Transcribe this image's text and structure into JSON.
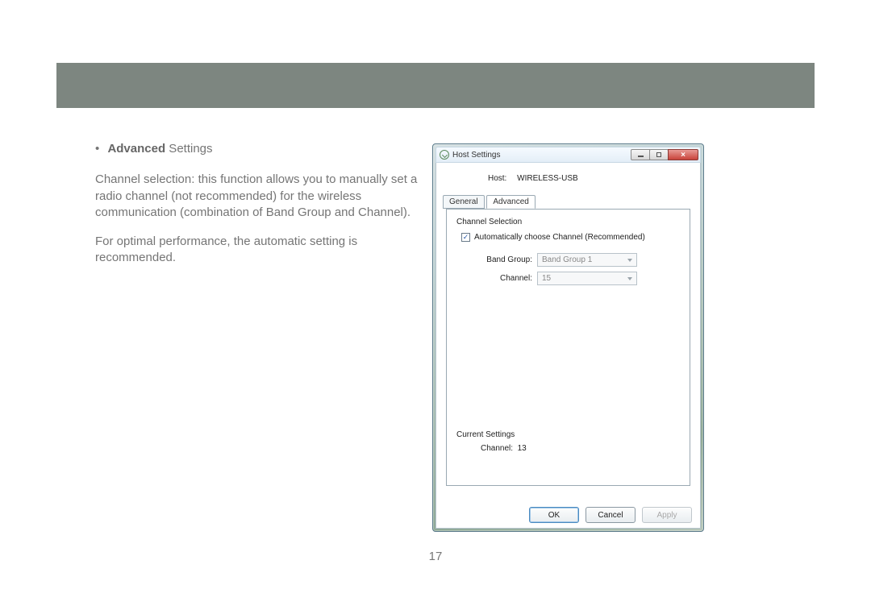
{
  "document": {
    "heading_bold": "Advanced",
    "heading_rest": " Settings",
    "para1": "Channel selection: this function allows you to manually set a radio channel (not recommended) for the wireless communication (combination of Band Group and Channel).",
    "para2": "For optimal performance, the automatic setting is recommended.",
    "page_number": "17"
  },
  "dialog": {
    "title": "Host Settings",
    "host_label": "Host:",
    "host_value": "WIRELESS-USB",
    "tabs": {
      "general": "General",
      "advanced": "Advanced"
    },
    "channel_selection_title": "Channel Selection",
    "auto_checkbox_label": "Automatically choose Channel (Recommended)",
    "auto_checked_glyph": "✓",
    "band_group_label": "Band Group:",
    "band_group_value": "Band Group 1",
    "channel_label": "Channel:",
    "channel_value": "15",
    "current_settings_title": "Current Settings",
    "current_channel_label": "Channel:",
    "current_channel_value": "13",
    "buttons": {
      "ok": "OK",
      "cancel": "Cancel",
      "apply": "Apply"
    }
  }
}
